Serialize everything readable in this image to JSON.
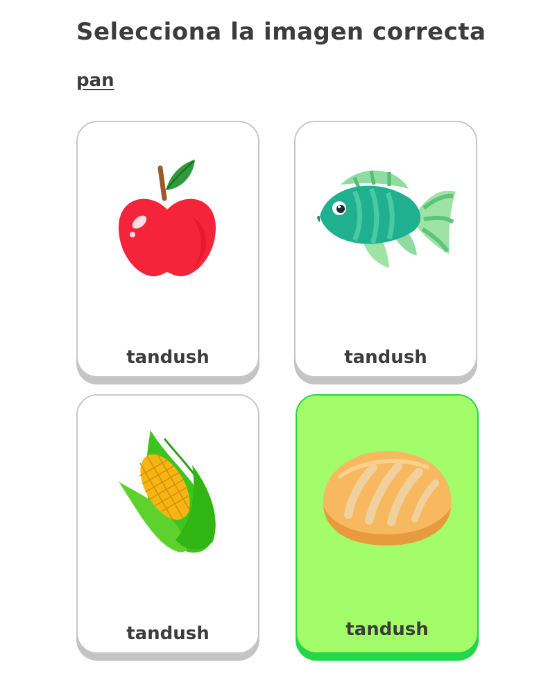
{
  "header": {
    "title": "Selecciona la imagen correcta",
    "prompt_word": "pan"
  },
  "cards": [
    {
      "label": "tandush",
      "icon": "apple-icon",
      "selected": false
    },
    {
      "label": "tandush",
      "icon": "fish-icon",
      "selected": false
    },
    {
      "label": "tandush",
      "icon": "corn-icon",
      "selected": false
    },
    {
      "label": "tandush",
      "icon": "bread-icon",
      "selected": true
    }
  ],
  "colors": {
    "text": "#3c3c3c",
    "card_border": "#c8c8c8",
    "selected_bg": "#a3fc6a",
    "selected_border": "#22d74a"
  }
}
